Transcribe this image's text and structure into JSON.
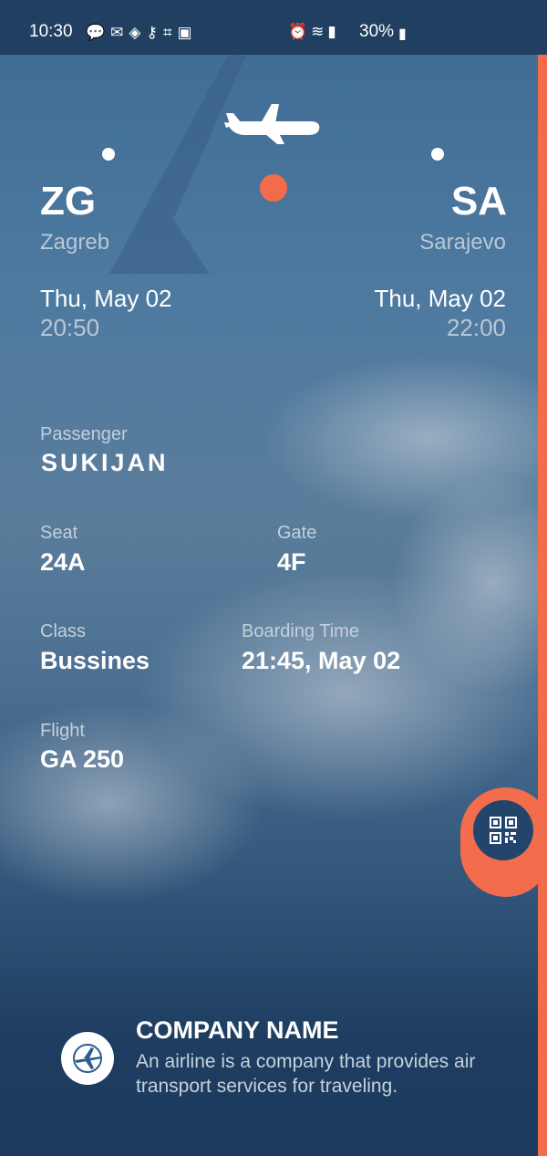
{
  "statusbar": {
    "time": "10:30",
    "battery": "30%",
    "icons_left": [
      "chat-icon",
      "mail-icon",
      "shield-icon",
      "key-icon",
      "scan-icon",
      "image-icon"
    ],
    "icons_right": [
      "alarm-icon",
      "wifi-icon",
      "signal-icon",
      "battery-icon"
    ]
  },
  "flight": {
    "origin": {
      "code": "ZG",
      "city": "Zagreb",
      "date": "Thu, May 02",
      "time": "20:50"
    },
    "destination": {
      "code": "SA",
      "city": "Sarajevo",
      "date": "Thu, May 02",
      "time": "22:00"
    }
  },
  "details": {
    "passenger_label": "Passenger",
    "passenger_value": "SUKIJAN",
    "seat_label": "Seat",
    "seat_value": "24A",
    "gate_label": "Gate",
    "gate_value": "4F",
    "class_label": "Class",
    "class_value": "Bussines",
    "boarding_label": "Boarding Time",
    "boarding_value": "21:45, May 02",
    "flight_label": "Flight",
    "flight_value": "GA 250"
  },
  "company": {
    "name": "COMPANY NAME",
    "description": "An airline is a company that provides air transport services for traveling."
  },
  "colors": {
    "accent": "#f36d4c",
    "background": "#2f5478",
    "statusbar": "#213f61"
  }
}
